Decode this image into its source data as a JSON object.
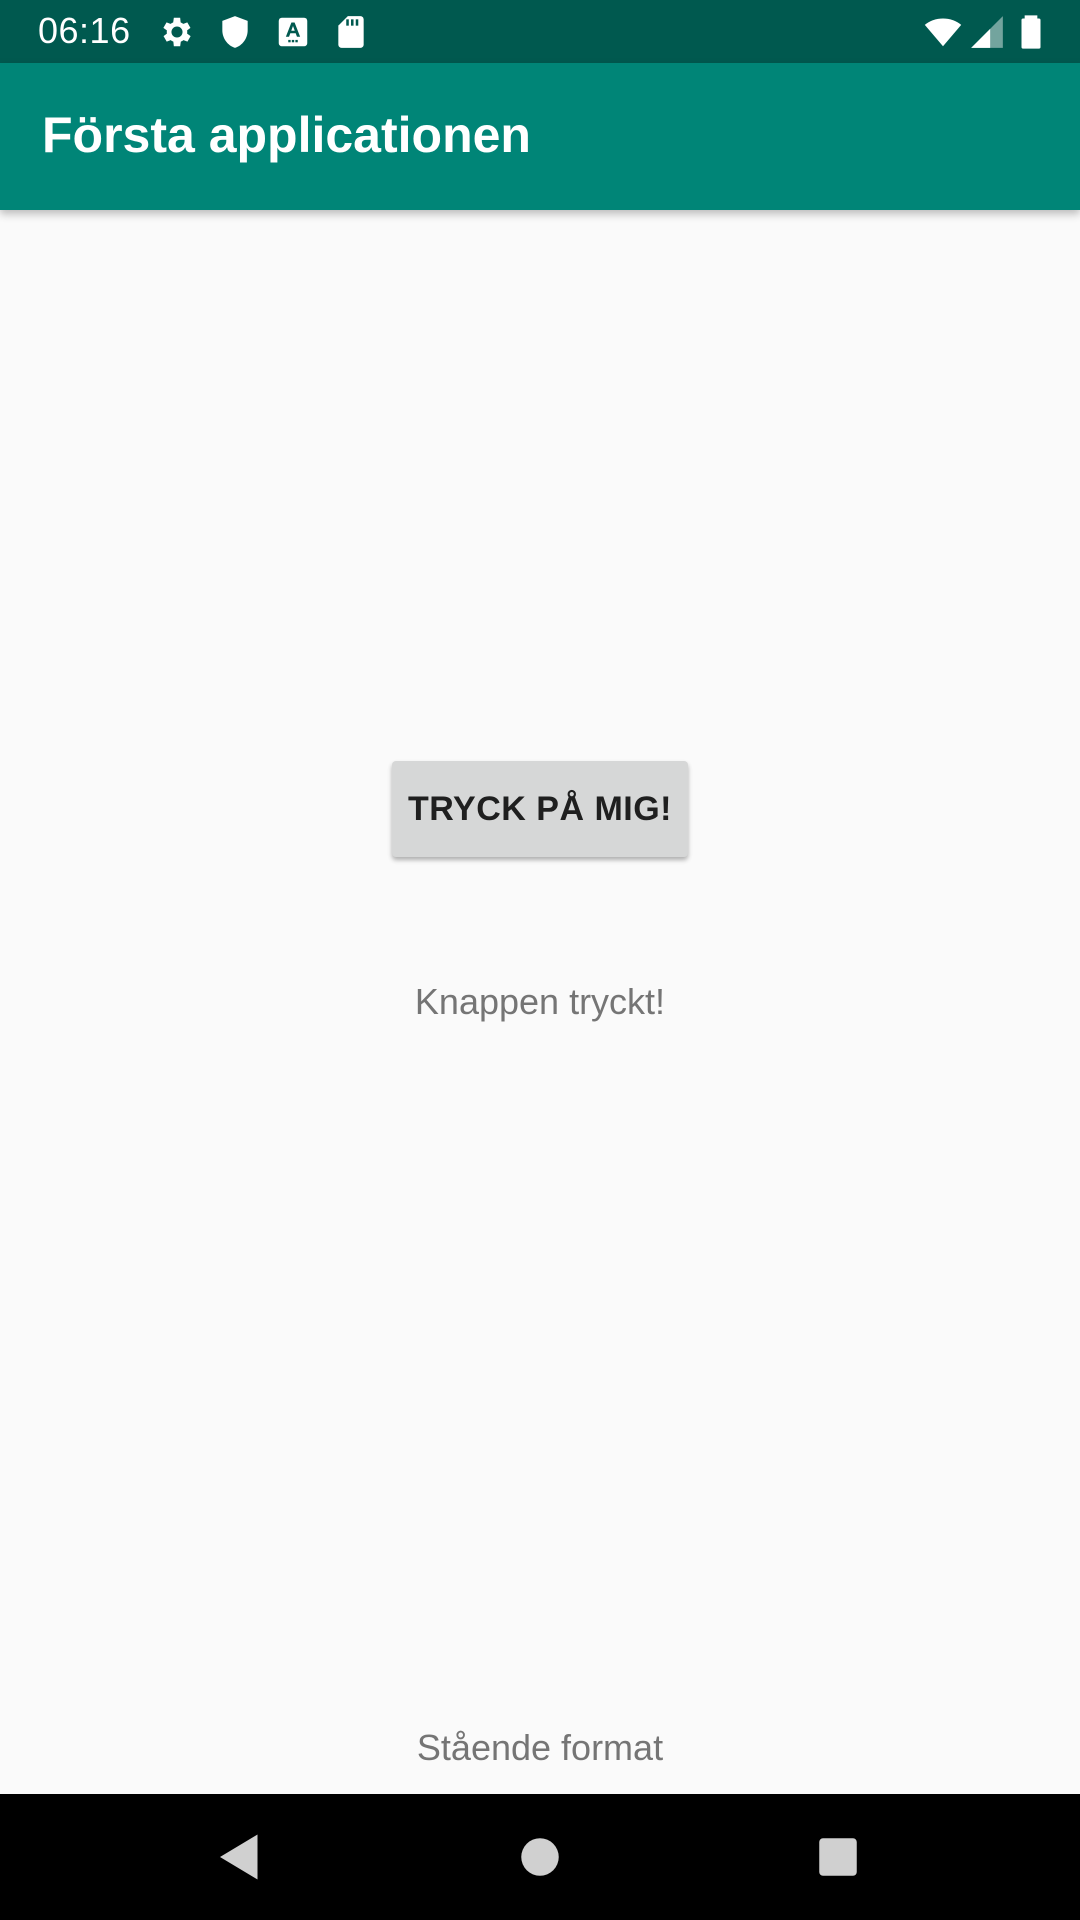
{
  "status_bar": {
    "time": "06:16",
    "icons": [
      "settings-icon",
      "shield-icon",
      "accessibility-a-icon",
      "sd-card-icon",
      "wifi-icon",
      "cell-signal-icon",
      "battery-icon"
    ]
  },
  "app_bar": {
    "title": "Första applicationen",
    "color": "#008577"
  },
  "main": {
    "button_label": "TRYCK PÅ MIG!",
    "result_text": "Knappen tryckt!",
    "orientation_text": "Stående format"
  },
  "nav_bar": {
    "buttons": [
      "back-icon",
      "home-icon",
      "recents-icon"
    ]
  },
  "colors": {
    "status_bar": "#00594f",
    "app_bar": "#008577",
    "background": "#fafafa",
    "button": "#d6d7d7",
    "secondary_text": "#757575"
  }
}
